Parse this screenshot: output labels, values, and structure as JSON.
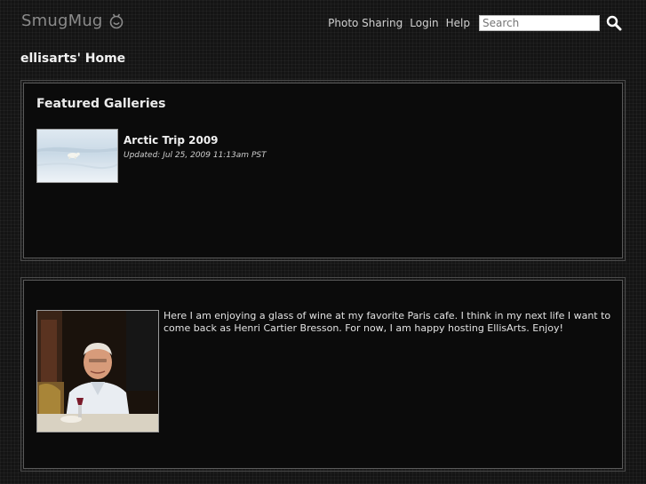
{
  "header": {
    "logo_text": "SmugMug",
    "nav": [
      "Photo Sharing",
      "Login",
      "Help"
    ],
    "search_placeholder": "Search",
    "search_value": "Search"
  },
  "page": {
    "title": "ellisarts' Home"
  },
  "featured": {
    "title": "Featured Galleries",
    "galleries": [
      {
        "title": "Arctic Trip 2009",
        "updated": "Updated: Jul 25, 2009 11:13am PST"
      }
    ]
  },
  "bio": {
    "text": "Here I am enjoying a glass of wine at my favorite Paris cafe. I think in my next life I want to come back as Henri Cartier Bresson. For now, I am happy hosting EllisArts. Enjoy!"
  },
  "icons": {
    "logo": "smugmug-face-icon",
    "search": "search-icon"
  }
}
